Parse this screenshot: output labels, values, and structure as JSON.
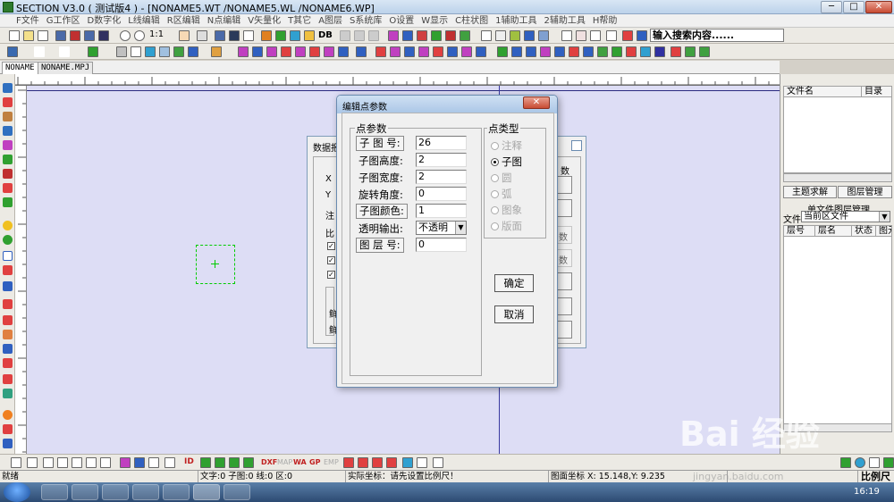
{
  "window": {
    "title": "SECTION V3.0 ( 测试版4 )  - [NONAME5.WT /NONAME5.WL /NONAME6.WP]",
    "minimize": "─",
    "maximize": "□",
    "close": "✕"
  },
  "menu": [
    "F文件",
    "G工作区",
    "D数字化",
    "L线编辑",
    "R区编辑",
    "N点编辑",
    "V矢量化",
    "T其它",
    "A图层",
    "S系统库",
    "O设置",
    "W显示",
    "C柱状图",
    "1辅助工具",
    "2辅助工具",
    "H帮助"
  ],
  "toolbar": {
    "zoom_label": "1:1",
    "db_label": "DB",
    "search_text": "输入搜索内容......"
  },
  "doc_tabs": [
    "NONAME",
    "NONAME.MPJ"
  ],
  "background_dialog": {
    "title": "数据报",
    "labels": [
      "X",
      "Y",
      "注",
      "比"
    ],
    "side_text": [
      "数",
      "数",
      "数",
      "数"
    ],
    "left_text": [
      "鲜",
      "鲜"
    ]
  },
  "dialog": {
    "title": "编辑点参数",
    "close": "✕",
    "point_params_title": "点参数",
    "fields": [
      {
        "label": "子 图 号:",
        "value": "26"
      },
      {
        "label": "子图高度:",
        "value": "2"
      },
      {
        "label": "子图宽度:",
        "value": "2"
      },
      {
        "label": "旋转角度:",
        "value": "0"
      },
      {
        "label": "子图颜色:",
        "value": "1"
      },
      {
        "label": "透明输出:",
        "value": "不透明"
      },
      {
        "label": "图 层 号:",
        "value": "0"
      }
    ],
    "point_type_title": "点类型",
    "point_types": [
      {
        "label": "注释",
        "selected": false,
        "disabled": true
      },
      {
        "label": "子图",
        "selected": true,
        "disabled": false
      },
      {
        "label": "圆",
        "selected": false,
        "disabled": true
      },
      {
        "label": "弧",
        "selected": false,
        "disabled": true
      },
      {
        "label": "图象",
        "selected": false,
        "disabled": true
      },
      {
        "label": "版面",
        "selected": false,
        "disabled": true
      }
    ],
    "ok": "确定",
    "cancel": "取消"
  },
  "right_panel": {
    "file_name_header": "文件名",
    "directory_header": "目录",
    "theme_search_button": "主题求解",
    "layer_manage_button": "图层管理",
    "single_file_layer_title": "单文件图层管理",
    "file_label": "文件",
    "file_select": "当前区文件",
    "columns": [
      "层号",
      "层名",
      "状态",
      "图元"
    ]
  },
  "status_bar": {
    "state": "就绪",
    "counts": "文字:0 子图:0 线:0 区:0",
    "real_coords": "实际坐标：请先设置比例尺！",
    "map_coords": "图面坐标 X:  15.148,Y:  9.235",
    "scale": "比例尺"
  },
  "bottom_labels": [
    "ID",
    "DXF",
    "MAP",
    "WA",
    "GP",
    "EMP"
  ],
  "taskbar": {
    "clock": "16:19"
  },
  "watermark": {
    "main": "Bai 经验",
    "sub": "jingyan.baidu.com"
  },
  "colors": {
    "canvas": "#ddddf5",
    "dialog_bg": "#f0f0f0",
    "selection": "#00cc00",
    "titlebar": "#bcd2ea"
  }
}
